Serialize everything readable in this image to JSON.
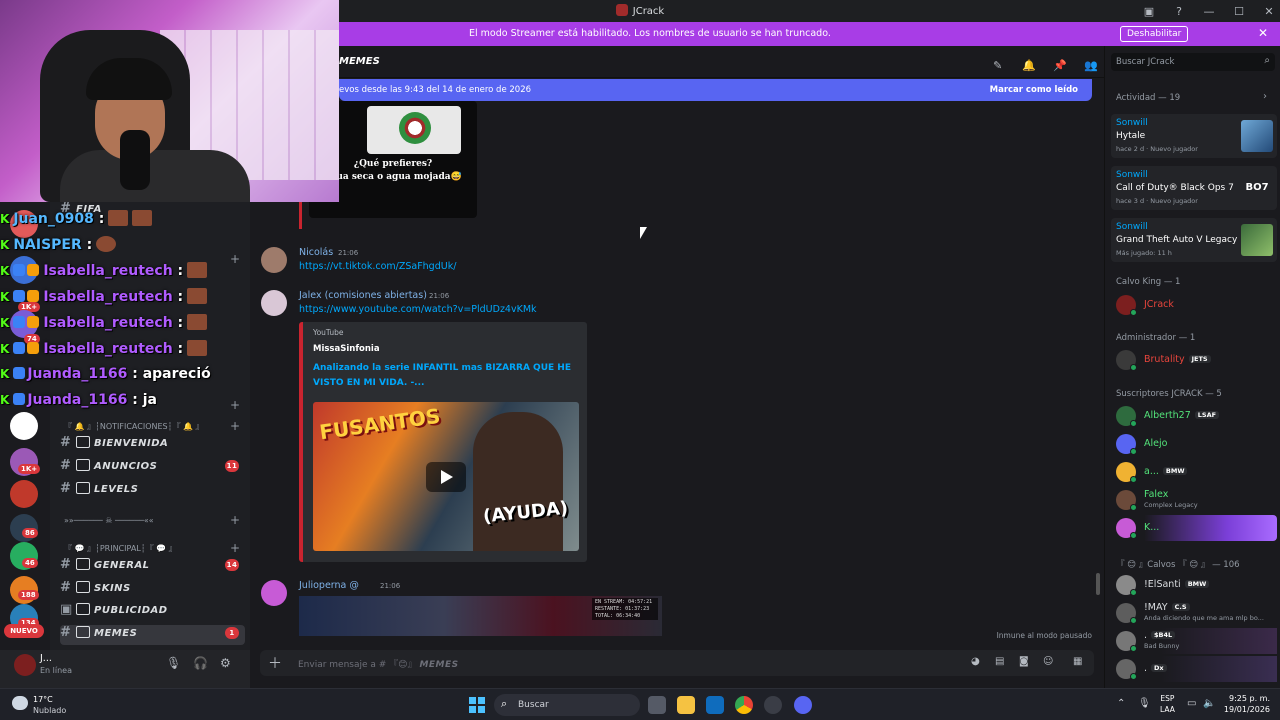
{
  "window": {
    "title": "JCrack"
  },
  "streamer_banner": {
    "message": "El modo Streamer está habilitado. Los nombres de usuario se han truncado.",
    "button": "Deshabilitar",
    "close": "✕"
  },
  "chat_overlay": [
    {
      "user": "Juan_0908",
      "sep": " :",
      "text": ""
    },
    {
      "user": "NAISPER",
      "sep": " :",
      "text": ""
    },
    {
      "user": "Isabella_reutech",
      "sep": " :",
      "text": ""
    },
    {
      "user": "Isabella_reutech",
      "sep": " :",
      "text": ""
    },
    {
      "user": "Isabella_reutech",
      "sep": " :",
      "text": ""
    },
    {
      "user": "Isabella_reutech",
      "sep": " :",
      "text": ""
    },
    {
      "user": "Juanda_1166",
      "sep": " :",
      "text": "apareció"
    },
    {
      "user": "Juanda_1166",
      "sep": " :",
      "text": "ja"
    }
  ],
  "sidebar": {
    "top_channels": [
      {
        "name": "FIFA"
      }
    ],
    "categories": [
      {
        "label": "『 🔔 』┆NOTIFICACIONES┆『 🔔 』"
      },
      {
        "label": "»»────── ☠ ──────««"
      },
      {
        "label": "『 💬 』┆PRINCIPAL┆『 💬 』"
      }
    ],
    "channels": [
      {
        "name": "BIENVENIDA",
        "count": ""
      },
      {
        "name": "ANUNCIOS",
        "count": "11"
      },
      {
        "name": "LEVELS",
        "count": ""
      },
      {
        "name": "GENERAL",
        "count": "14"
      },
      {
        "name": "SKINS",
        "count": ""
      },
      {
        "name": "PUBLICIDAD",
        "count": ""
      },
      {
        "name": "MEMES",
        "count": "1"
      }
    ],
    "server_badges": [
      "1K+",
      "74",
      "1K+",
      "86",
      "46",
      "188",
      "134"
    ],
    "nuevo": "NUEVO"
  },
  "user_panel": {
    "name": "J...",
    "status": "En línea"
  },
  "header": {
    "channel": "MEMES"
  },
  "new_messages": {
    "text": "evos desde las 9:43 del 14 de enero de 2026",
    "mark_read": "Marcar como leído"
  },
  "messages": [
    {
      "image_caption_1": "¿Qué prefieres?",
      "image_caption_2": "agua seca o agua mojada😅"
    },
    {
      "author": "Nicolás",
      "time": "21:06",
      "link": "https://vt.tiktok.com/ZSaFhgdUk/"
    },
    {
      "author": "Jalex (comisiones abiertas)",
      "time": "21:06",
      "link": "https://www.youtube.com/watch?v=PldUDz4vKMk",
      "embed": {
        "provider": "YouTube",
        "author": "MissaSinfonia",
        "title": "Analizando la serie INFANTIL mas BIZARRA QUE HE VISTO EN MI VIDA. -...",
        "thumb_logo": "FUSANTOS",
        "thumb_text": "(AYUDA)"
      }
    },
    {
      "author": "Julioperna @",
      "time": "21:06",
      "stats": [
        "EN STREAM: 04:57:21",
        "RESTANTE: 01:37:23",
        "TOTAL: 06:34:40"
      ]
    }
  ],
  "paused": "Inmune al modo pausado",
  "composer": {
    "prefix": "Enviar mensaje a # 『😊』",
    "channel": "MEMES"
  },
  "members_panel": {
    "search_placeholder": "Buscar JCrack",
    "activity_header": "Actividad — 19",
    "activities": [
      {
        "user": "Sonwill",
        "game": "Hytale",
        "meta": "hace 2 d  ·  Nuevo jugador"
      },
      {
        "user": "Sonwill",
        "game": "Call of Duty® Black Ops 7",
        "meta": "hace 3 d  ·  Nuevo jugador",
        "cover": "BO7"
      },
      {
        "user": "Sonwill",
        "game": "Grand Theft Auto V Legacy",
        "meta": "Más jugado: 11 h"
      }
    ],
    "groups": [
      {
        "header": "Calvo King — 1",
        "members": [
          {
            "name": "JCrack",
            "color": "#e8453c",
            "tag": "",
            "sub": ""
          }
        ]
      },
      {
        "header": "Administrador — 1",
        "members": [
          {
            "name": "Brutality",
            "color": "#e8453c",
            "tag": "JETS",
            "sub": ""
          }
        ]
      },
      {
        "header": "Suscriptores JCRACK — 5",
        "members": [
          {
            "name": "Alberth27",
            "color": "#53e37a",
            "tag": "LSAF",
            "sub": ""
          },
          {
            "name": "Alejo",
            "color": "#53e37a",
            "tag": "",
            "sub": ""
          },
          {
            "name": "a...",
            "color": "#53e37a",
            "tag": "BMW",
            "sub": ""
          },
          {
            "name": "Falex",
            "color": "#53e37a",
            "tag": "",
            "sub": "Complex Legacy"
          },
          {
            "name": "K...",
            "color": "#53e37a",
            "tag": "",
            "sub": ""
          }
        ]
      },
      {
        "header": "『 😊 』Calvos 『 😊 』 — 106",
        "members": [
          {
            "name": "!ElSanti",
            "color": "#dbdee1",
            "tag": "BMW",
            "sub": ""
          },
          {
            "name": "!MAY",
            "color": "#dbdee1",
            "tag": "C.S",
            "sub": "Anda diciendo que me ama mlp bo..."
          },
          {
            "name": ".",
            "color": "#dbdee1",
            "tag": "$B4L",
            "sub": "Bad Bunny"
          },
          {
            "name": ".",
            "color": "#dbdee1",
            "tag": "Dx",
            "sub": ""
          }
        ]
      }
    ]
  },
  "taskbar": {
    "weather_temp": "17°C",
    "weather_desc": "Nublado",
    "search": "Buscar",
    "lang_1": "ESP",
    "lang_2": "LAA",
    "time": "9:25 p. m.",
    "date": "19/01/2026"
  }
}
